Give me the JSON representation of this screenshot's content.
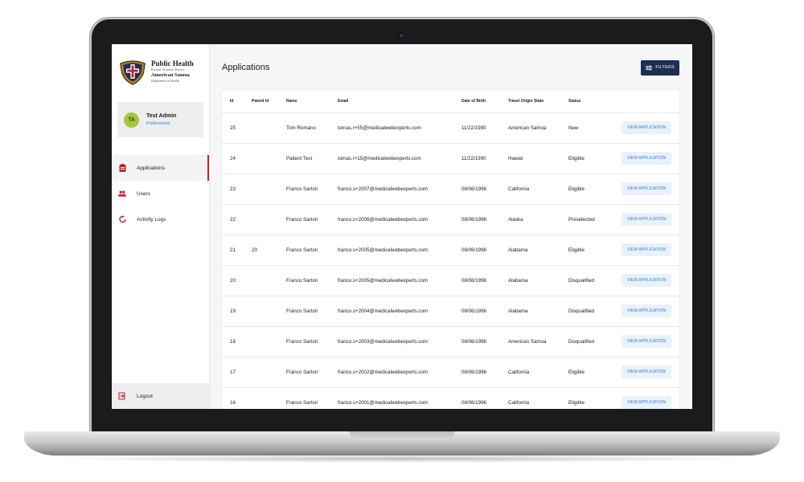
{
  "app": {
    "logo_title": "Public Health",
    "logo_tagline": "Prevent. Promote. Protect.",
    "logo_subtitle": "American Samoa",
    "logo_department": "Department of Health"
  },
  "user": {
    "initials": "TA",
    "name": "Test Admin",
    "preferences_link": "Preferences"
  },
  "sidebar": {
    "items": [
      {
        "label": "Applications",
        "icon": "clipboard-icon",
        "active": true
      },
      {
        "label": "Users",
        "icon": "users-icon",
        "active": false
      },
      {
        "label": "Activity Logs",
        "icon": "refresh-icon",
        "active": false
      }
    ],
    "logout_label": "Logout"
  },
  "page": {
    "title": "Applications",
    "filters_label": "FILTERS"
  },
  "table": {
    "headers": [
      "Id",
      "Parent Id",
      "Name",
      "Email",
      "Date of Birth",
      "Travel Origin State",
      "Status"
    ],
    "action_label": "VIEW APPLICATION",
    "rows": [
      {
        "id": "25",
        "parent_id": "",
        "name": "Tom Romano",
        "email": "tomas.r+55@medicalwebexperts.com",
        "dob": "11/22/1990",
        "state": "American Samoa",
        "status": "New"
      },
      {
        "id": "24",
        "parent_id": "",
        "name": "Patient Test",
        "email": "tomas.r+15@medicalwebexperts.com",
        "dob": "11/22/1990",
        "state": "Hawaii",
        "status": "Eligible"
      },
      {
        "id": "23",
        "parent_id": "",
        "name": "Franco Sartori",
        "email": "franco.s+2007@medicalwebexperts.com",
        "dob": "08/06/1996",
        "state": "California",
        "status": "Eligible"
      },
      {
        "id": "22",
        "parent_id": "",
        "name": "Franco Sartori",
        "email": "franco.s+2006@medicalwebexperts.com",
        "dob": "08/06/1996",
        "state": "Alaska",
        "status": "Preselected"
      },
      {
        "id": "21",
        "parent_id": "20",
        "name": "Franco Sartori",
        "email": "franco.s+2005@medicalwebexperts.com",
        "dob": "08/06/1996",
        "state": "Alabama",
        "status": "Eligible"
      },
      {
        "id": "20",
        "parent_id": "",
        "name": "Franco Sartori",
        "email": "franco.s+2005@medicalwebexperts.com",
        "dob": "08/06/1996",
        "state": "Alabama",
        "status": "Disqualified"
      },
      {
        "id": "19",
        "parent_id": "",
        "name": "Franco Sartori",
        "email": "franco.s+2004@medicalwebexperts.com",
        "dob": "08/06/1996",
        "state": "Alabama",
        "status": "Disqualified"
      },
      {
        "id": "18",
        "parent_id": "",
        "name": "Franco Sartori",
        "email": "franco.s+2003@medicalwebexperts.com",
        "dob": "08/06/1996",
        "state": "American Samoa",
        "status": "Disqualified"
      },
      {
        "id": "17",
        "parent_id": "",
        "name": "Franco Sartori",
        "email": "franco.s+2002@medicalwebexperts.com",
        "dob": "08/06/1996",
        "state": "California",
        "status": "Eligible"
      },
      {
        "id": "16",
        "parent_id": "",
        "name": "Franco Sartori",
        "email": "franco.s+2001@medicalwebexperts.com",
        "dob": "08/06/1996",
        "state": "California",
        "status": "Eligible"
      }
    ]
  },
  "colors": {
    "accent_red": "#c0202f",
    "filters_bg": "#1d2e52",
    "link_blue": "#2b7bd6",
    "avatar_green": "#a3c73e"
  }
}
